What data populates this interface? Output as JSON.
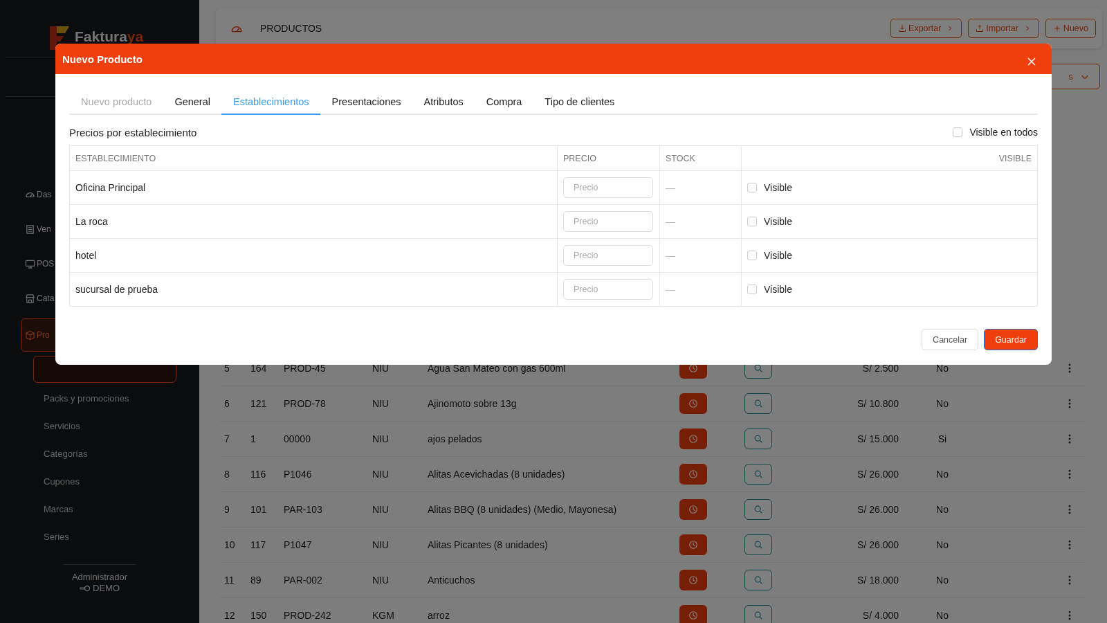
{
  "sidebar": {
    "logo": {
      "first": "Faktura",
      "second": "ya"
    },
    "items": [
      {
        "label": "Das",
        "selected": false
      },
      {
        "label": "Ven",
        "selected": false
      },
      {
        "label": "POS",
        "selected": false
      },
      {
        "label": "Cata",
        "selected": false
      },
      {
        "label": "Pro",
        "selected": true
      }
    ],
    "subitems": [
      {
        "label": "Packs y promociones"
      },
      {
        "label": "Servicios"
      },
      {
        "label": "Categorías"
      },
      {
        "label": "Cupones"
      },
      {
        "label": "Marcas"
      },
      {
        "label": "Series"
      }
    ],
    "user": {
      "name": "Administrador",
      "role": "DEMO"
    }
  },
  "header": {
    "title": "PRODUCTOS",
    "buttons": [
      {
        "label": "Exportar",
        "kind": "export"
      },
      {
        "label": "Importar",
        "kind": "import"
      },
      {
        "label": "Nuevo",
        "kind": "new"
      }
    ],
    "filter_button": "s"
  },
  "products": [
    {
      "n": "5",
      "id": "164",
      "code": "PROD-45",
      "unit": "NIU",
      "name": "Agua San Mateo con gas 600ml",
      "price": "S/ 2.500",
      "visible": "No"
    },
    {
      "n": "6",
      "id": "121",
      "code": "PROD-78",
      "unit": "NIU",
      "name": "Ajinomoto sobre 13g",
      "price": "S/ 10.800",
      "visible": "No"
    },
    {
      "n": "7",
      "id": "1",
      "code": "00000",
      "unit": "NIU",
      "name": "ajos pelados",
      "price": "S/ 15.000",
      "visible": "Si"
    },
    {
      "n": "8",
      "id": "116",
      "code": "P1046",
      "unit": "NIU",
      "name": "Alitas Acevichadas (8 unidades)",
      "price": "S/ 26.000",
      "visible": "No"
    },
    {
      "n": "9",
      "id": "101",
      "code": "PAR-103",
      "unit": "NIU",
      "name": "Alitas BBQ (8 unidades) (Medio, Mayonesa)",
      "price": "S/ 26.000",
      "visible": "No"
    },
    {
      "n": "10",
      "id": "117",
      "code": "P1047",
      "unit": "NIU",
      "name": "Alitas Picantes (8 unidades)",
      "price": "S/ 26.000",
      "visible": "No"
    },
    {
      "n": "11",
      "id": "89",
      "code": "PAR-002",
      "unit": "NIU",
      "name": "Anticuchos",
      "price": "S/ 18.000",
      "visible": "No"
    },
    {
      "n": "12",
      "id": "150",
      "code": "PROD-242",
      "unit": "KGM",
      "name": "arroz",
      "price": "S/ 4.000",
      "visible": "No"
    }
  ],
  "modal": {
    "title": "Nuevo Producto",
    "tabs": [
      {
        "label": "Nuevo producto",
        "selected": false,
        "disabled": true
      },
      {
        "label": "General",
        "selected": false,
        "disabled": false
      },
      {
        "label": "Establecimientos",
        "selected": true,
        "disabled": false
      },
      {
        "label": "Presentaciones",
        "selected": false,
        "disabled": false
      },
      {
        "label": "Atributos",
        "selected": false,
        "disabled": false
      },
      {
        "label": "Compra",
        "selected": false,
        "disabled": false
      },
      {
        "label": "Tipo de clientes",
        "selected": false,
        "disabled": false
      }
    ],
    "section_title": "Precios por establecimiento",
    "visible_all": {
      "label": "Visible en todos",
      "checked": false
    },
    "columns": [
      "ESTABLECIMIENTO",
      "PRECIO",
      "STOCK",
      "VISIBLE"
    ],
    "rows": [
      {
        "name": "Oficina Principal",
        "price_placeholder": "Precio",
        "stock": "—",
        "visible_label": "Visible",
        "checked": false
      },
      {
        "name": "La roca",
        "price_placeholder": "Precio",
        "stock": "—",
        "visible_label": "Visible",
        "checked": false
      },
      {
        "name": "hotel",
        "price_placeholder": "Precio",
        "stock": "—",
        "visible_label": "Visible",
        "checked": false
      },
      {
        "name": "sucursal de prueba",
        "price_placeholder": "Precio",
        "stock": "—",
        "visible_label": "Visible",
        "checked": false
      }
    ],
    "buttons": {
      "cancel": "Cancelar",
      "save": "Guardar"
    }
  }
}
